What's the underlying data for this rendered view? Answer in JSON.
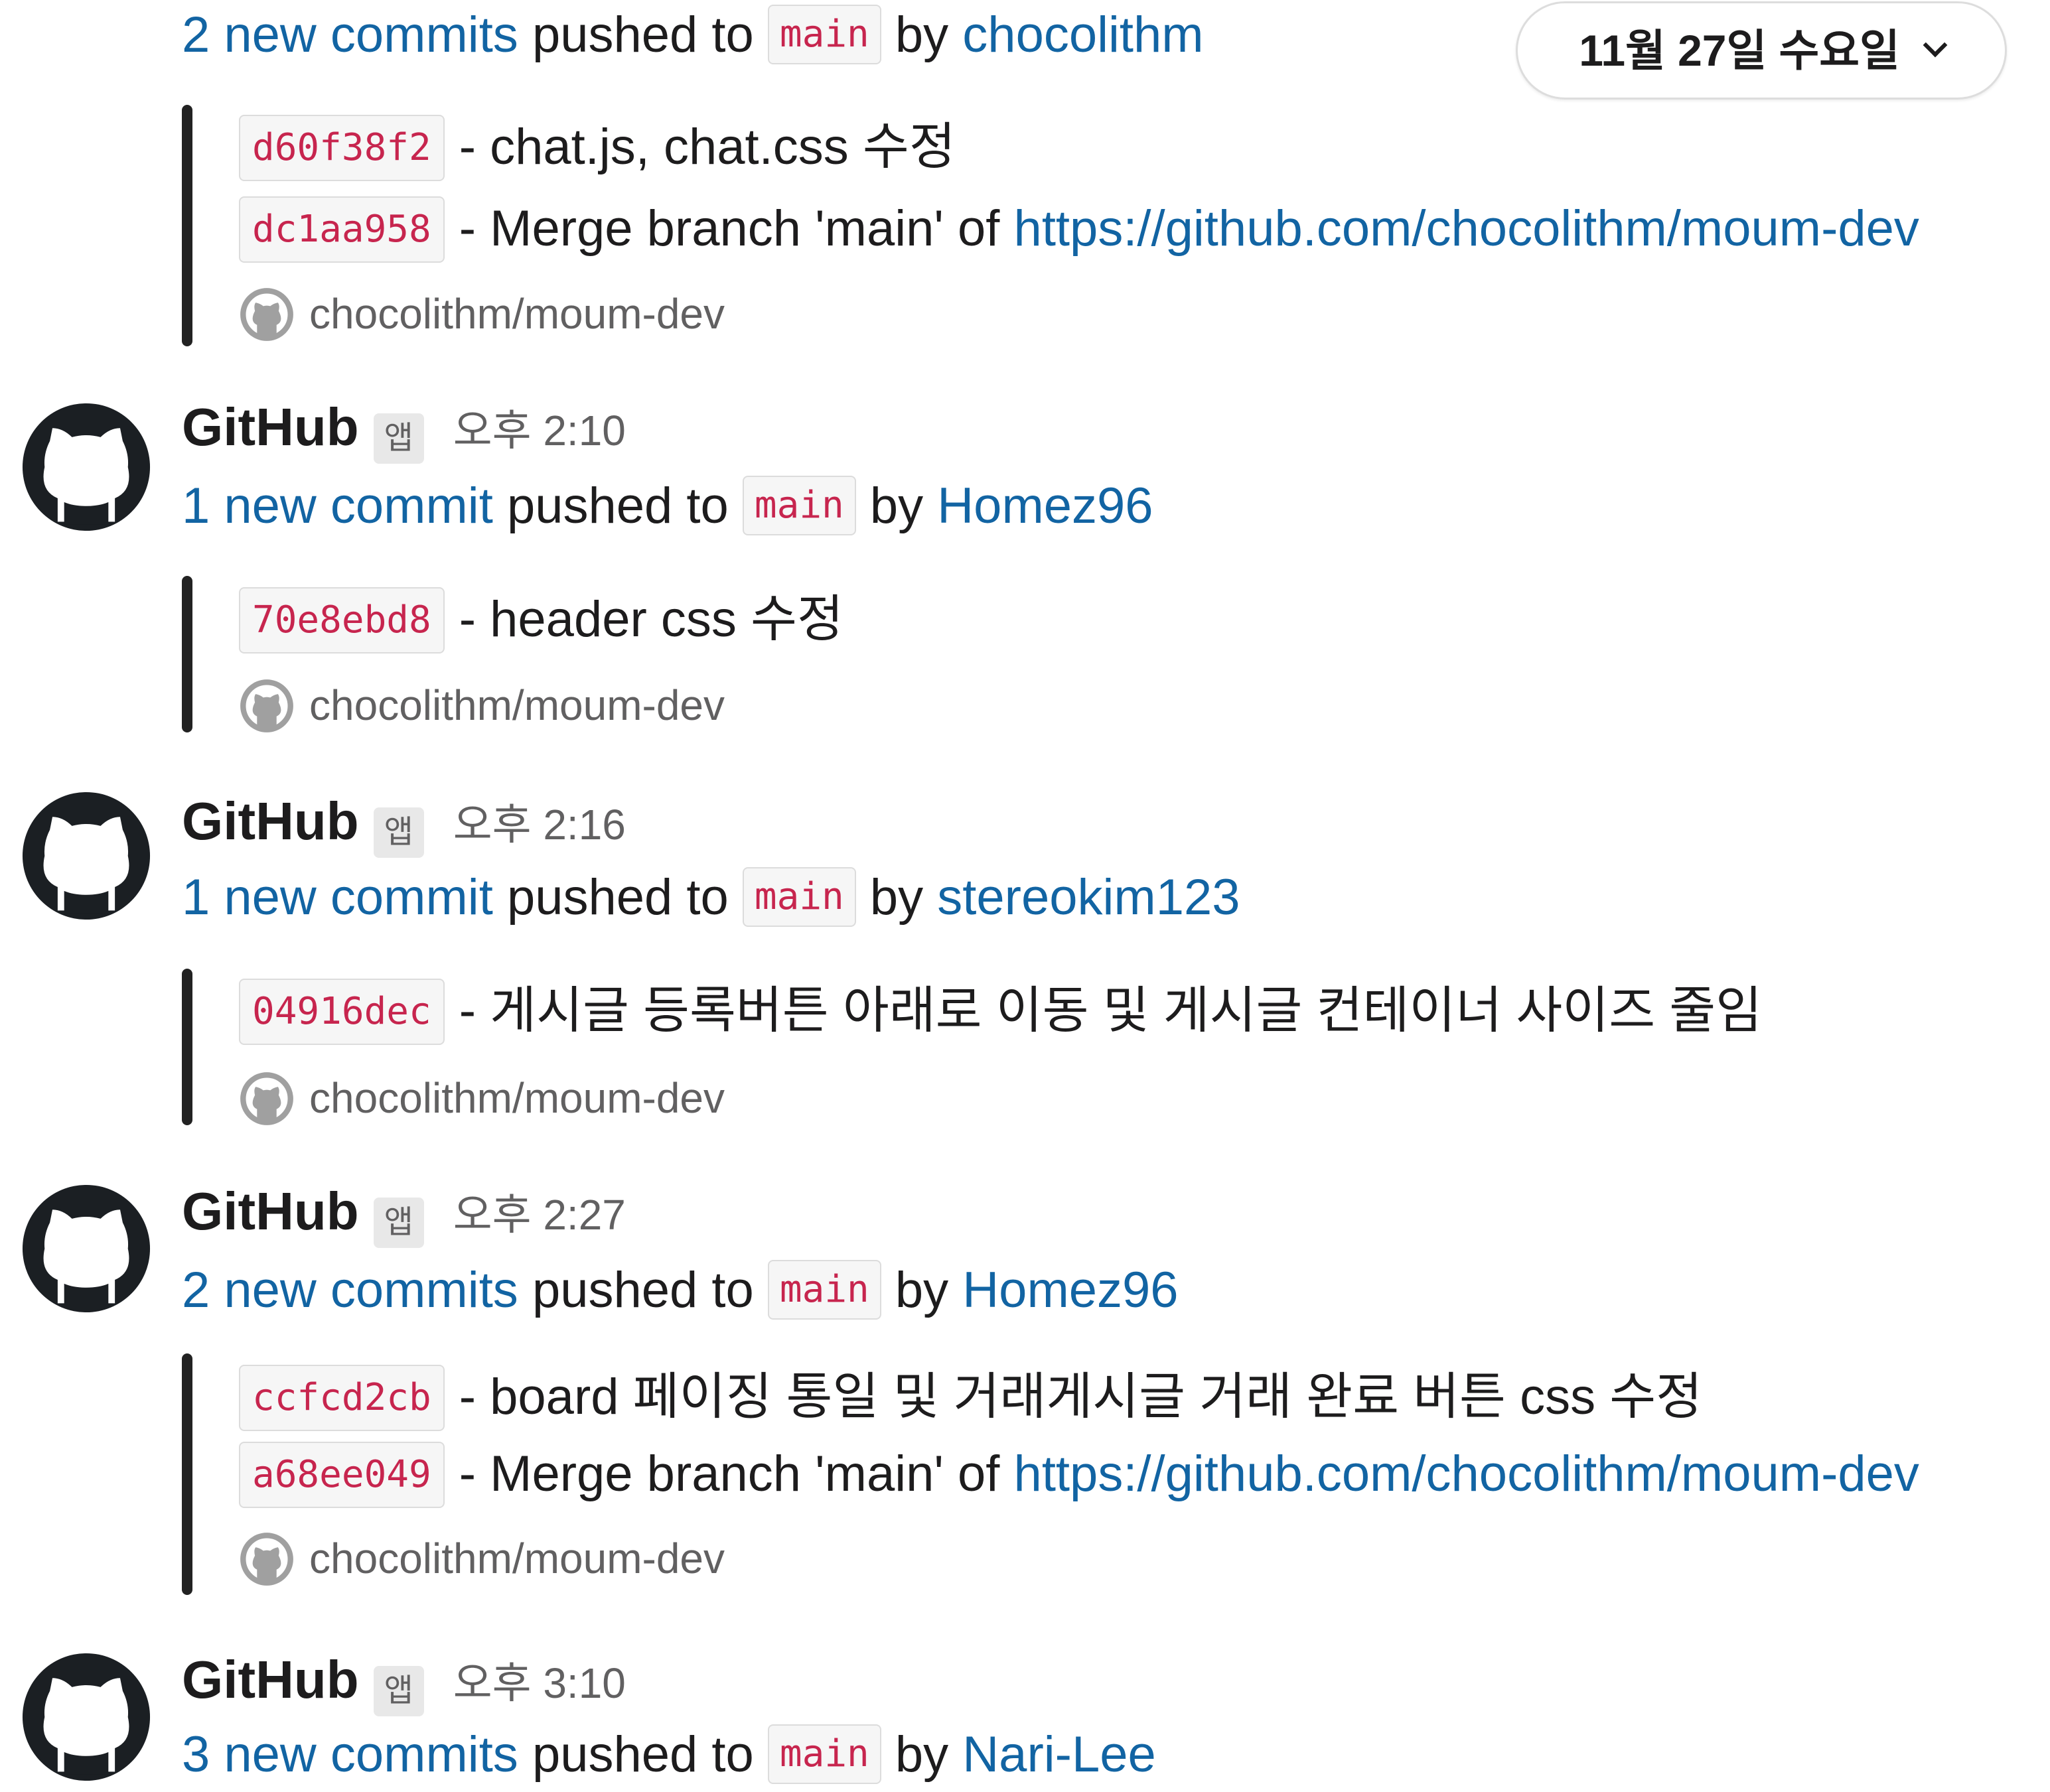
{
  "date_divider": {
    "label": "11월 27일 수요일",
    "icon": "chevron-down-icon"
  },
  "icons": {
    "avatar": "github-octocat-icon",
    "repo": "github-logo-icon"
  },
  "code_color": "#c7254e",
  "link_color": "#1264a3",
  "messages": [
    {
      "summary": {
        "count_text": "2 new commits",
        "pushed_text": "pushed to",
        "branch": "main",
        "by_text": "by",
        "author": "chocolithm"
      },
      "commits": [
        {
          "sha": "d60f38f2",
          "text": "- chat.js, chat.css 수정"
        },
        {
          "sha": "dc1aa958",
          "text": "- Merge branch 'main' of ",
          "link": "https://github.com/chocolithm/moum-dev"
        }
      ],
      "repo": "chocolithm/moum-dev"
    },
    {
      "sender": "GitHub",
      "badge": "앱",
      "time": "오후 2:10",
      "summary": {
        "count_text": "1 new commit",
        "pushed_text": "pushed to",
        "branch": "main",
        "by_text": "by",
        "author": "Homez96"
      },
      "commits": [
        {
          "sha": "70e8ebd8",
          "text": "- header css 수정"
        }
      ],
      "repo": "chocolithm/moum-dev"
    },
    {
      "sender": "GitHub",
      "badge": "앱",
      "time": "오후 2:16",
      "summary": {
        "count_text": "1 new commit",
        "pushed_text": "pushed to",
        "branch": "main",
        "by_text": "by",
        "author": "stereokim123"
      },
      "commits": [
        {
          "sha": "04916dec",
          "text": "- 게시글 등록버튼 아래로 이동 및 게시글 컨테이너 사이즈 줄임"
        }
      ],
      "repo": "chocolithm/moum-dev"
    },
    {
      "sender": "GitHub",
      "badge": "앱",
      "time": "오후 2:27",
      "summary": {
        "count_text": "2 new commits",
        "pushed_text": "pushed to",
        "branch": "main",
        "by_text": "by",
        "author": "Homez96"
      },
      "commits": [
        {
          "sha": "ccfcd2cb",
          "text": "- board 페이징 통일 및 거래게시글 거래 완료 버튼 css 수정"
        },
        {
          "sha": "a68ee049",
          "text": "- Merge branch 'main' of ",
          "link": "https://github.com/chocolithm/moum-dev"
        }
      ],
      "repo": "chocolithm/moum-dev"
    },
    {
      "sender": "GitHub",
      "badge": "앱",
      "time": "오후 3:10",
      "summary": {
        "count_text": "3 new commits",
        "pushed_text": "pushed to",
        "branch": "main",
        "by_text": "by",
        "author": "Nari-Lee"
      }
    }
  ]
}
